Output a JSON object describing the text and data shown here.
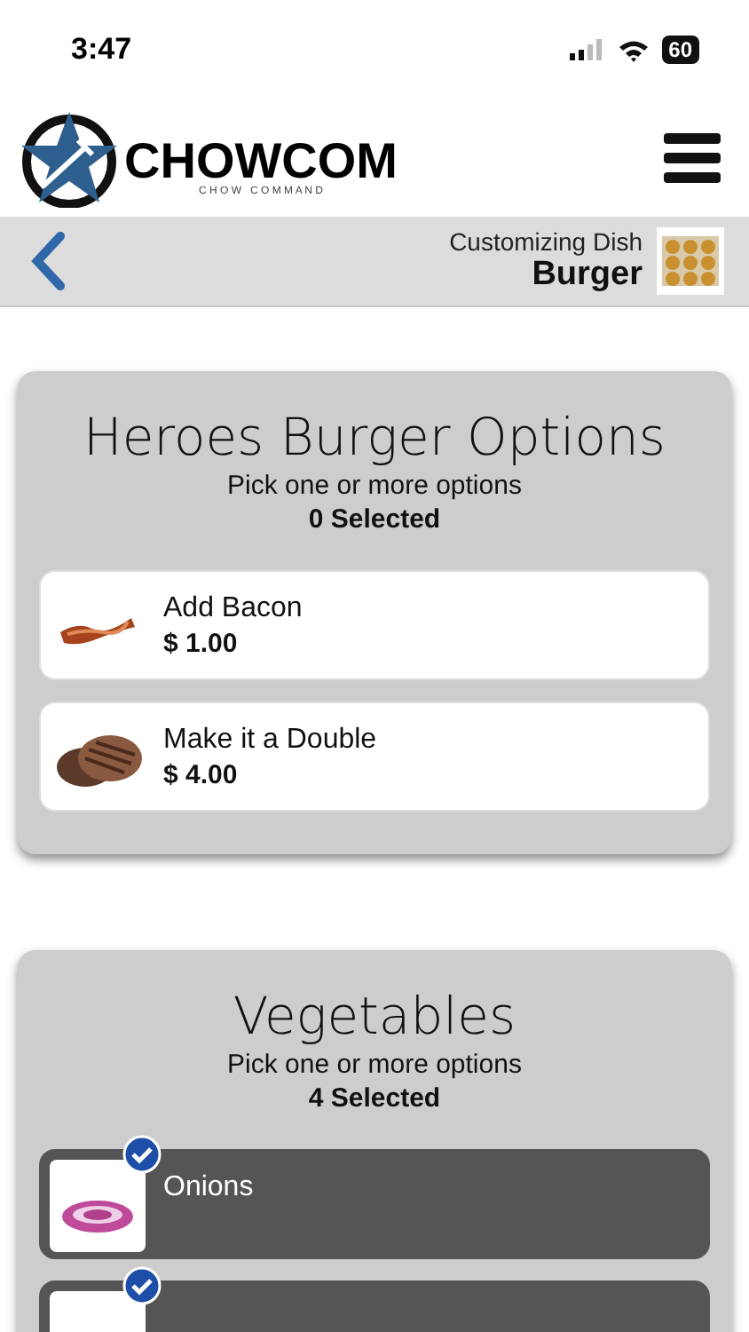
{
  "status_bar": {
    "time": "3:47",
    "battery": "60"
  },
  "header": {
    "logo": {
      "name": "CHOWCOM",
      "tagline": "C H O W   C O M M A N D"
    }
  },
  "dish_bar": {
    "label": "Customizing Dish",
    "dish": "Burger"
  },
  "groups": [
    {
      "title": "Heroes Burger Options",
      "subtitle": "Pick one or more options",
      "count": "0 Selected",
      "options": [
        {
          "name": "Add Bacon",
          "price": "$ 1.00",
          "selected": false
        },
        {
          "name": "Make it a Double",
          "price": "$ 4.00",
          "selected": false
        }
      ]
    },
    {
      "title": "Vegetables",
      "subtitle": "Pick one or more options",
      "count": "4 Selected",
      "options": [
        {
          "name": "Onions",
          "selected": true
        },
        {
          "selected": true
        }
      ]
    }
  ]
}
